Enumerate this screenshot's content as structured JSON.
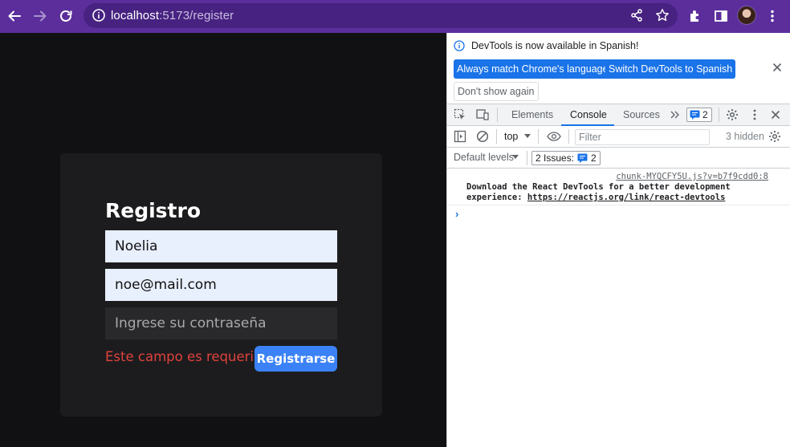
{
  "browser": {
    "url_host": "localhost",
    "url_path": ":5173/register"
  },
  "form": {
    "title": "Registro",
    "name_value": "Noelia",
    "email_value": "noe@mail.com",
    "password_placeholder": "Ingrese su contraseña",
    "error_message": "Este campo es requerido",
    "submit_label": "Registrarse"
  },
  "devtools": {
    "banner_text": "DevTools is now available in Spanish!",
    "btn_match_language": "Always match Chrome's language",
    "btn_switch_spanish": "Switch DevTools to Spanish",
    "btn_dont_show": "Don't show again",
    "tabs": [
      "Elements",
      "Console",
      "Sources"
    ],
    "active_tab": "Console",
    "issues_badge_count": "2",
    "context": "top",
    "filter_placeholder": "Filter",
    "hidden_count": "3 hidden",
    "default_levels": "Default levels",
    "issues_label": "2 Issues:",
    "issues_count": "2",
    "message_source": "chunk-MYQCFY5U.js?v=b7f9cdd0:8",
    "message_line1": "Download the React DevTools for a better development",
    "message_line2_prefix": "experience: ",
    "message_link": "https://reactjs.org/link/react-devtools",
    "prompt_symbol": "›"
  },
  "colors": {
    "toolbar": "#5b2e9c",
    "page_background": "#111113",
    "card_background": "#1c1c1e",
    "accent_button": "#3b82f6",
    "error_text": "#e0423c",
    "devtools_blue": "#1a73e8"
  },
  "icons": [
    "back-arrow-icon",
    "forward-arrow-icon",
    "reload-icon",
    "info-icon",
    "share-icon",
    "star-icon",
    "extensions-icon",
    "side-panel-icon",
    "menu-kebab-icon",
    "inspect-icon",
    "device-toolbar-icon",
    "settings-gear-icon",
    "close-icon",
    "sidebar-toggle-icon",
    "clear-console-icon",
    "eye-icon",
    "chat-icon"
  ]
}
